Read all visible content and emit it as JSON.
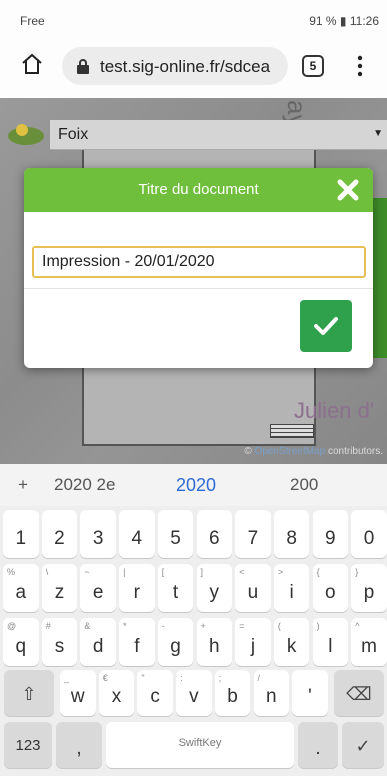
{
  "status_bar": {
    "carrier": "Free",
    "right_text": "91 %",
    "time": "11:26"
  },
  "browser": {
    "url": "test.sig-online.fr/sdcea",
    "tab_count": "5"
  },
  "map": {
    "layer_select_value": "Foix",
    "street_label": "ayle",
    "place_label": "Julien d'",
    "attribution_prefix": "©",
    "attribution_link": "OpenStreetMap",
    "attribution_suffix": "contributors."
  },
  "dialog": {
    "title": "Titre du document",
    "input_value": "Impression - 20/01/2020"
  },
  "keyboard": {
    "suggestions": [
      "+",
      "2020 2e",
      "2020",
      "200"
    ],
    "number_row": [
      "1",
      "2",
      "3",
      "4",
      "5",
      "6",
      "7",
      "8",
      "9",
      "0"
    ],
    "row1": [
      {
        "main": "a",
        "sub": "%"
      },
      {
        "main": "z",
        "sub": "\\"
      },
      {
        "main": "e",
        "sub": "~"
      },
      {
        "main": "r",
        "sub": "|"
      },
      {
        "main": "t",
        "sub": "["
      },
      {
        "main": "y",
        "sub": "]"
      },
      {
        "main": "u",
        "sub": "<"
      },
      {
        "main": "i",
        "sub": ">"
      },
      {
        "main": "o",
        "sub": "{"
      },
      {
        "main": "p",
        "sub": "}"
      }
    ],
    "row2": [
      {
        "main": "q",
        "sub": "@"
      },
      {
        "main": "s",
        "sub": "#"
      },
      {
        "main": "d",
        "sub": "&"
      },
      {
        "main": "f",
        "sub": "*"
      },
      {
        "main": "g",
        "sub": "-"
      },
      {
        "main": "h",
        "sub": "+"
      },
      {
        "main": "j",
        "sub": "="
      },
      {
        "main": "k",
        "sub": "("
      },
      {
        "main": "l",
        "sub": ")"
      },
      {
        "main": "m",
        "sub": "^"
      }
    ],
    "row3": [
      {
        "main": "w",
        "sub": "_"
      },
      {
        "main": "x",
        "sub": "€"
      },
      {
        "main": "c",
        "sub": "\""
      },
      {
        "main": "v",
        "sub": ":"
      },
      {
        "main": "b",
        "sub": ";"
      },
      {
        "main": "n",
        "sub": "/"
      },
      {
        "main": "'",
        "sub": ""
      }
    ],
    "symbols_key": "123",
    "comma_key": ",",
    "space_label": "SwiftKey",
    "period_key": "."
  },
  "colors": {
    "dialog_header": "#6fbf3c",
    "ok_button": "#2fa14d",
    "input_border": "#e8bf56",
    "suggestion_active": "#2c6bd4"
  },
  "icons": {
    "home": "home-icon",
    "lock": "lock-icon",
    "menu": "more-vert-icon",
    "close": "close-x-icon",
    "ok": "checkmark-icon",
    "shift": "shift-icon",
    "backspace": "backspace-icon",
    "enter": "enter-icon"
  }
}
